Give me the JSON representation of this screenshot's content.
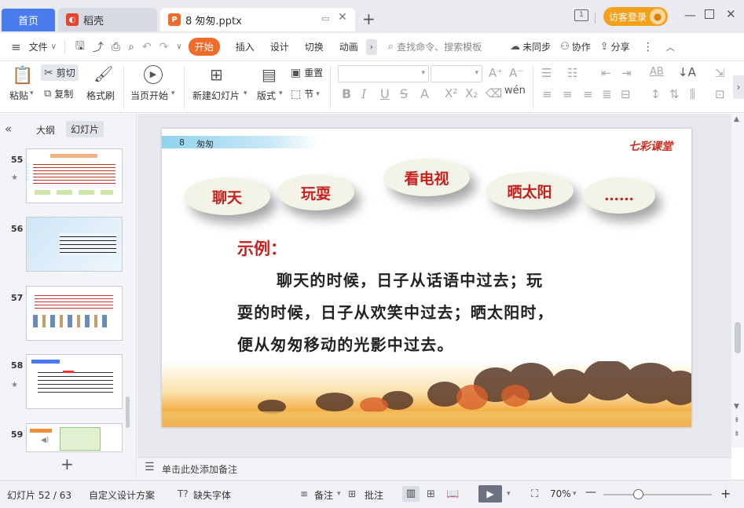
{
  "titlebar": {
    "tabs": [
      {
        "label": "首页"
      },
      {
        "label": "稻壳"
      },
      {
        "label": "8 匆匆.pptx"
      }
    ],
    "new_tab": "+",
    "visitor_login": "访客登录"
  },
  "menu": {
    "file": "文件",
    "tabs": [
      "开始",
      "插入",
      "设计",
      "切换",
      "动画"
    ],
    "search_placeholder": "查找命令、搜索模板",
    "sync": "未同步",
    "collab": "协作",
    "share": "分享"
  },
  "ribbon": {
    "paste": "粘贴",
    "cut": "剪切",
    "copy": "复制",
    "format_painter": "格式刷",
    "from_start": "当页开始",
    "new_slide": "新建幻灯片",
    "layout": "版式",
    "reset": "重置",
    "section": "节"
  },
  "panel": {
    "outline_tab": "大纲",
    "slides_tab": "幻灯片",
    "slide_numbers": [
      "55",
      "56",
      "57",
      "58",
      "59"
    ],
    "add": "+"
  },
  "slide": {
    "header_num": "8",
    "header_title": "匆匆",
    "brand": "七彩课堂",
    "clouds": [
      "聊天",
      "玩耍",
      "看电视",
      "晒太阳",
      "……"
    ],
    "example_label": "示例：",
    "body_line1": "聊天的时候，日子从话语中过去；玩",
    "body_line2": "耍的时候，日子从欢笑中过去；晒太阳时，",
    "body_line3": "便从匆匆移动的光影中过去。"
  },
  "notes": {
    "placeholder": "单击此处添加备注"
  },
  "status": {
    "slide_counter": "幻灯片 52 / 63",
    "design": "自定义设计方案",
    "missing_font": "缺失字体",
    "notes": "备注",
    "comments": "批注",
    "zoom": "70%",
    "zoom_level": 0.7
  },
  "colors": {
    "accent_blue": "#4a7cf0",
    "start_tab": "#ef6b2c",
    "cloud_text": "#c8201f",
    "visitor": "#f3a11c"
  }
}
